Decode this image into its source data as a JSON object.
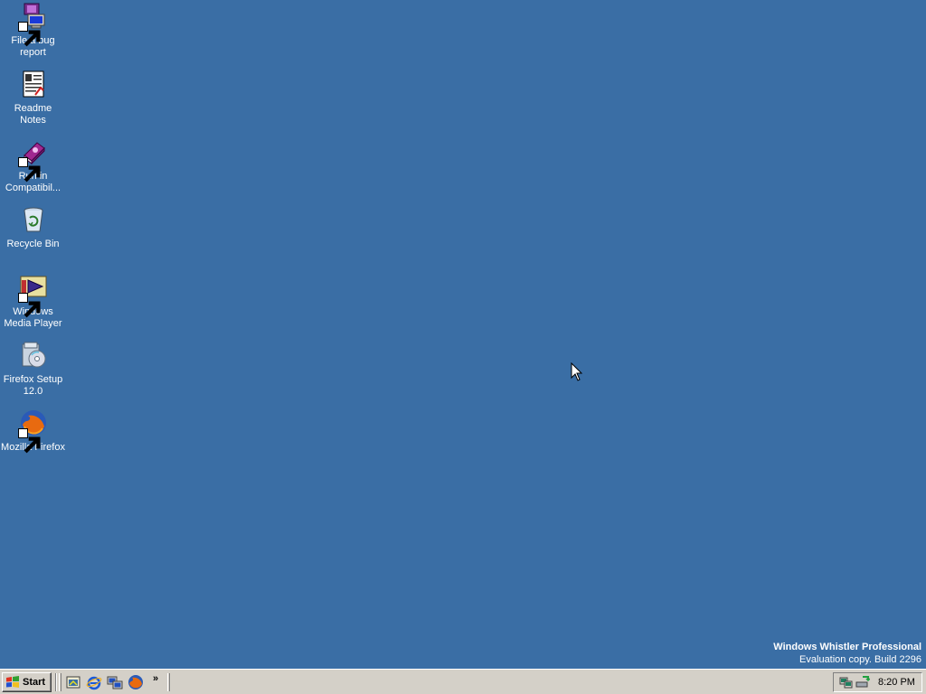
{
  "desktop": {
    "background_color": "#3A6EA5",
    "icons": [
      {
        "label": "File a bug report",
        "icon": "bug-report-shortcut-icon",
        "shortcut": true
      },
      {
        "label": "Readme Notes",
        "icon": "document-icon",
        "shortcut": false
      },
      {
        "label": "Run in Compatibil...",
        "icon": "compatibility-book-shortcut-icon",
        "shortcut": true
      },
      {
        "label": "Recycle Bin",
        "icon": "recycle-bin-icon",
        "shortcut": false
      },
      {
        "label": "Windows Media Player",
        "icon": "media-player-shortcut-icon",
        "shortcut": true
      },
      {
        "label": "Firefox Setup 12.0",
        "icon": "installer-icon",
        "shortcut": false
      },
      {
        "label": "Mozilla Firefox",
        "icon": "firefox-shortcut-icon",
        "shortcut": true
      }
    ]
  },
  "watermark": {
    "line1": "Windows Whistler Professional",
    "line2": "Evaluation copy. Build 2296"
  },
  "taskbar": {
    "start_label": "Start",
    "quick_launch": [
      {
        "icon": "show-desktop-icon"
      },
      {
        "icon": "internet-explorer-icon"
      },
      {
        "icon": "network-wizard-icon"
      },
      {
        "icon": "firefox-icon"
      }
    ],
    "overflow_label": "»",
    "tray_icons": [
      {
        "icon": "network-connection-icon"
      },
      {
        "icon": "safely-remove-hardware-icon"
      }
    ],
    "clock": "8:20 PM"
  }
}
